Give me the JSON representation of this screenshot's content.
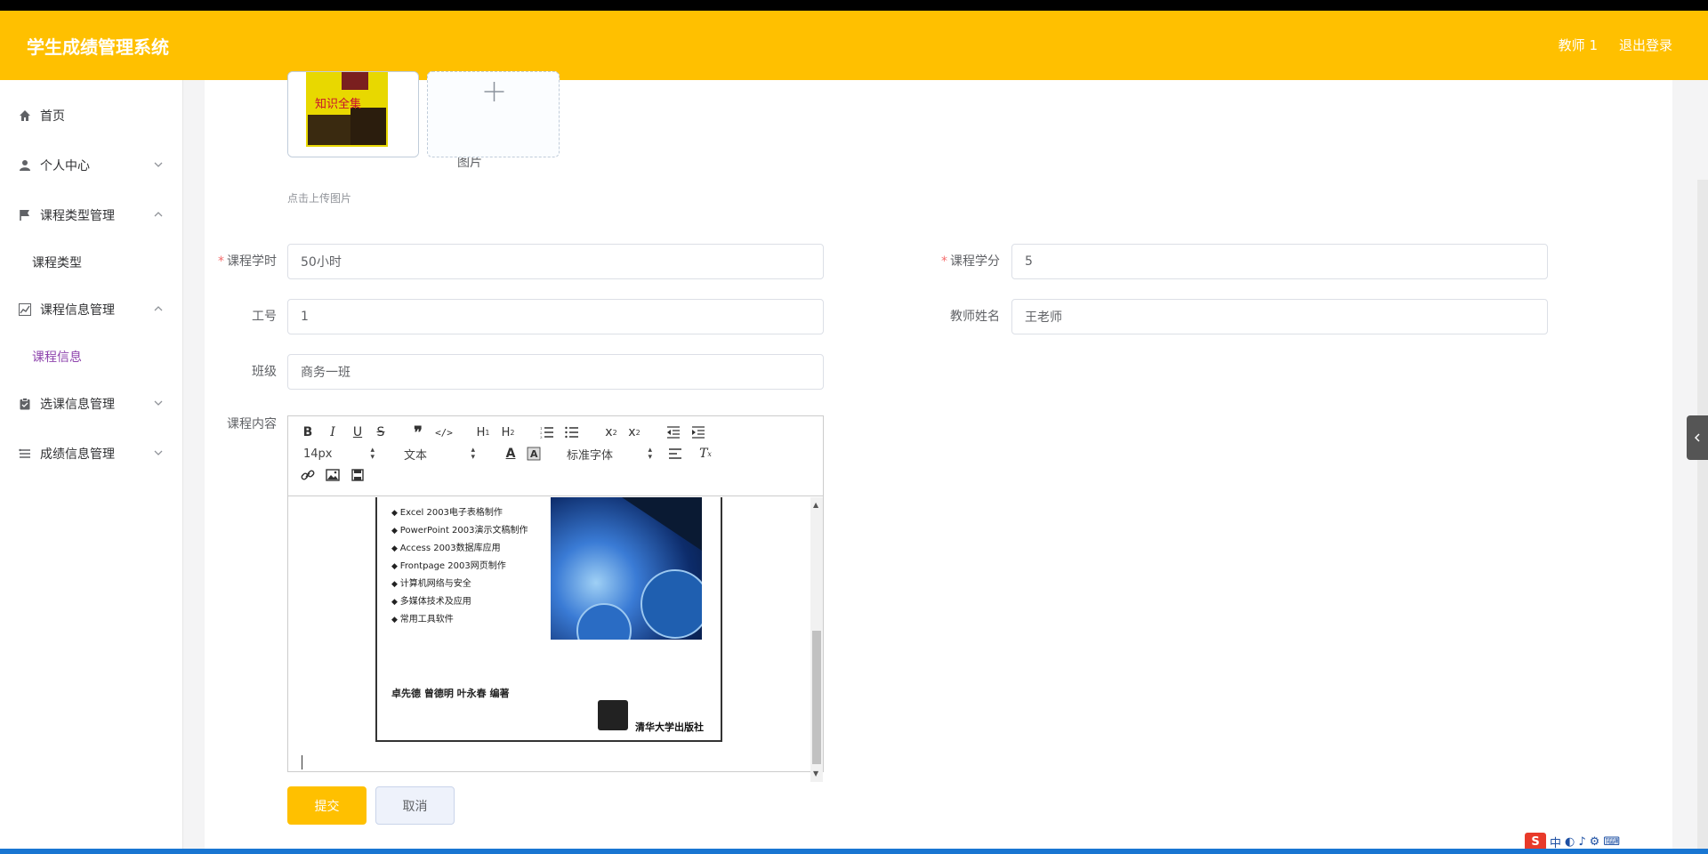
{
  "header": {
    "app_title": "学生成绩管理系统",
    "user_label": "教师 1",
    "logout_label": "退出登录"
  },
  "sidebar": {
    "items": [
      {
        "label": "首页",
        "icon": "home-icon"
      },
      {
        "label": "个人中心",
        "icon": "user-icon"
      },
      {
        "label": "课程类型管理",
        "icon": "flag-icon"
      },
      {
        "label": "课程信息管理",
        "icon": "trend-chart-icon"
      },
      {
        "label": "选课信息管理",
        "icon": "clipboard-icon"
      },
      {
        "label": "成绩信息管理",
        "icon": "list-icon"
      }
    ],
    "subitems": {
      "course_type": "课程类型",
      "course_info": "课程信息"
    }
  },
  "form": {
    "image_label": "图片",
    "upload_tip": "点击上传图片",
    "hours_label": "课程学时",
    "hours_value": "50小时",
    "credit_label": "课程学分",
    "credit_value": "5",
    "job_no_label": "工号",
    "job_no_value": "1",
    "teacher_label": "教师姓名",
    "teacher_value": "王老师",
    "class_label": "班级",
    "class_value": "商务一班",
    "content_label": "课程内容"
  },
  "editor": {
    "font_size": "14px",
    "block_type": "文本",
    "font_family": "标准字体",
    "book_items": [
      "Excel 2003电子表格制作",
      "PowerPoint 2003演示文稿制作",
      "Access 2003数据库应用",
      "Frontpage 2003网页制作",
      "计算机网络与安全",
      "多媒体技术及应用",
      "常用工具软件"
    ],
    "book_authors": "卓先德  曾德明  叶永春    编著",
    "book_publisher": "清华大学出版社",
    "cover_title": "知识全集"
  },
  "buttons": {
    "submit": "提交",
    "cancel": "取消"
  },
  "colors": {
    "header_bg": "#ffc000",
    "active_menu": "#8e44ad",
    "required_star": "#f56c6c"
  }
}
